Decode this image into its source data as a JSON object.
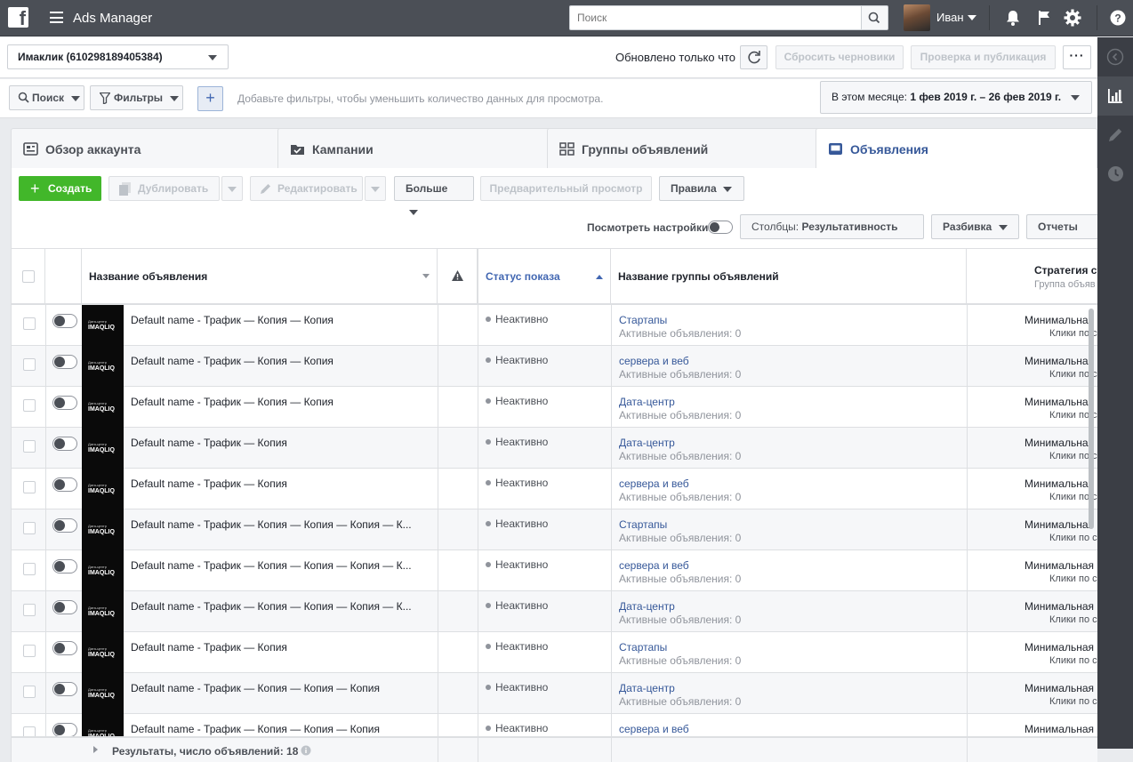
{
  "topbar": {
    "app_title": "Ads Manager",
    "search_placeholder": "Поиск",
    "user_name": "Иван"
  },
  "account": {
    "name": "Имаклик (610298189405384)",
    "updated_text": "Обновлено только что",
    "discard_drafts": "Сбросить черновики",
    "review_publish": "Проверка и публикация"
  },
  "filters": {
    "search_label": "Поиск",
    "filters_label": "Фильтры",
    "hint": "Добавьте фильтры, чтобы уменьшить количество данных для просмотра.",
    "date_prefix": "В этом месяце: ",
    "date_range": "1 фев 2019 г. – 26 фев 2019 г."
  },
  "tabs": [
    {
      "label": "Обзор аккаунта"
    },
    {
      "label": "Кампании"
    },
    {
      "label": "Группы объявлений"
    },
    {
      "label": "Объявления"
    }
  ],
  "toolbar": {
    "create": "Создать",
    "duplicate": "Дублировать",
    "edit": "Редактировать",
    "more": "Больше",
    "preview": "Предварительный просмотр",
    "rules": "Правила",
    "view_settings": "Посмотреть настройки",
    "columns_prefix": "Столбцы: ",
    "columns_value": "Результативность",
    "breakdown": "Разбивка",
    "reports": "Отчеты"
  },
  "table": {
    "columns": {
      "ad_name": "Название объявления",
      "delivery": "Статус показа",
      "adset_name": "Название группы объявлений",
      "strategy": "Стратегия ст",
      "strategy_sub": "Группа объяв"
    },
    "thumb_caption": "Дата-центр",
    "thumb_brand": "IMAQLIQ",
    "rows": [
      {
        "name": "Default name - Трафик — Копия — Копия",
        "status": "Неактивно",
        "group": "Стартапы",
        "active": "Активные объявления: 0",
        "strategy": "Минимальная",
        "strategy_sub": "Клики по со"
      },
      {
        "name": "Default name - Трафик — Копия — Копия",
        "status": "Неактивно",
        "group": "сервера и веб",
        "active": "Активные объявления: 0",
        "strategy": "Минимальная",
        "strategy_sub": "Клики по со"
      },
      {
        "name": "Default name - Трафик — Копия — Копия",
        "status": "Неактивно",
        "group": "Дата-центр",
        "active": "Активные объявления: 0",
        "strategy": "Минимальная",
        "strategy_sub": "Клики по со"
      },
      {
        "name": "Default name - Трафик — Копия",
        "status": "Неактивно",
        "group": "Дата-центр",
        "active": "Активные объявления: 0",
        "strategy": "Минимальная",
        "strategy_sub": "Клики по со"
      },
      {
        "name": "Default name - Трафик — Копия",
        "status": "Неактивно",
        "group": "сервера и веб",
        "active": "Активные объявления: 0",
        "strategy": "Минимальная",
        "strategy_sub": "Клики по со"
      },
      {
        "name": "Default name - Трафик — Копия — Копия — Копия — К...",
        "status": "Неактивно",
        "group": "Стартапы",
        "active": "Активные объявления: 0",
        "strategy": "Минимальная",
        "strategy_sub": "Клики по со"
      },
      {
        "name": "Default name - Трафик — Копия — Копия — Копия — К...",
        "status": "Неактивно",
        "group": "сервера и веб",
        "active": "Активные объявления: 0",
        "strategy": "Минимальная",
        "strategy_sub": "Клики по со"
      },
      {
        "name": "Default name - Трафик — Копия — Копия — Копия — К...",
        "status": "Неактивно",
        "group": "Дата-центр",
        "active": "Активные объявления: 0",
        "strategy": "Минимальная",
        "strategy_sub": "Клики по со"
      },
      {
        "name": "Default name - Трафик — Копия",
        "status": "Неактивно",
        "group": "Стартапы",
        "active": "Активные объявления: 0",
        "strategy": "Минимальная",
        "strategy_sub": "Клики по со"
      },
      {
        "name": "Default name - Трафик — Копия — Копия — Копия",
        "status": "Неактивно",
        "group": "Дата-центр",
        "active": "Активные объявления: 0",
        "strategy": "Минимальная",
        "strategy_sub": "Клики по со"
      },
      {
        "name": "Default name - Трафик — Копия — Копия — Копия",
        "status": "Неактивно",
        "group": "сервера и веб",
        "active": "",
        "strategy": "Минимальная",
        "strategy_sub": ""
      }
    ],
    "footer": "Результаты, число объявлений: 18"
  },
  "colors": {
    "topbar": "#4b4f56",
    "link": "#365899",
    "create": "#42b72a",
    "rightpanel": "#3b3e45"
  }
}
